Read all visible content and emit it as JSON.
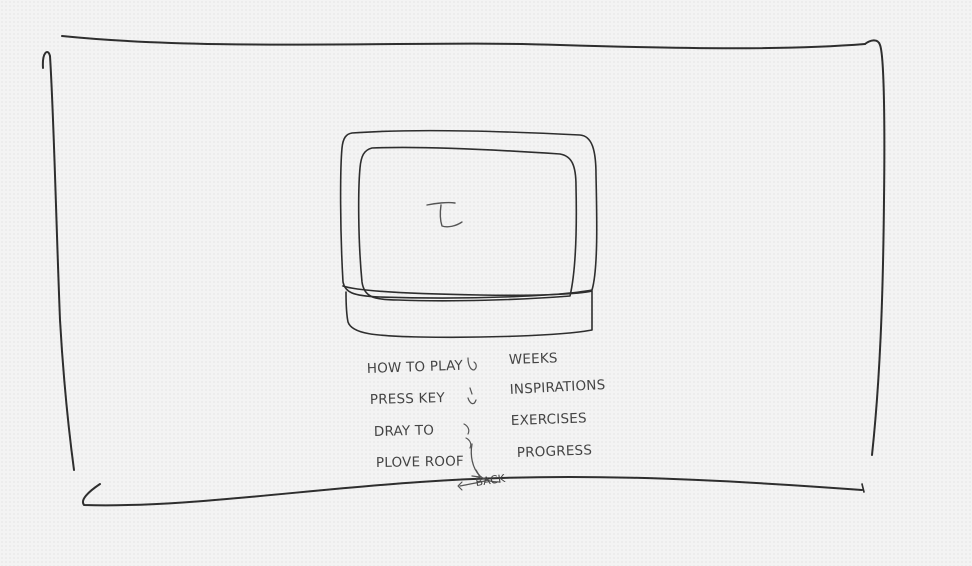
{
  "sketch": {
    "screen_glyph": "Z",
    "left_menu": [
      "HOW TO PLAY",
      "PRESS KEY",
      "DRAY TO",
      "PLOVE ROOF"
    ],
    "right_menu": [
      "WEEKS",
      "INSPIRATIONS",
      "EXERCISES",
      "PROGRESS"
    ],
    "back_label": "BACK"
  }
}
